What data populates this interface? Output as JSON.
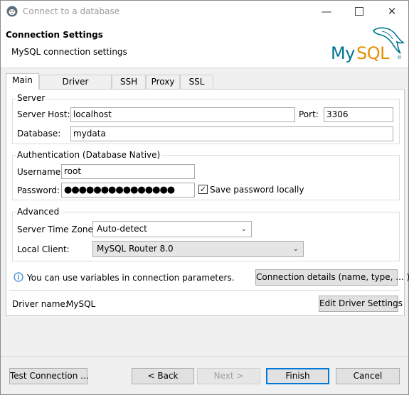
{
  "window": {
    "title": "Connect to a database"
  },
  "header": {
    "title": "Connection Settings",
    "subtitle": "MySQL connection settings",
    "logo_icon": "mysql-dolphin-logo"
  },
  "tabs": [
    {
      "label": "Main",
      "active": true
    },
    {
      "label": "Driver properties"
    },
    {
      "label": "SSH"
    },
    {
      "label": "Proxy"
    },
    {
      "label": "SSL"
    }
  ],
  "server": {
    "legend": "Server",
    "host_label": "Server Host:",
    "host_value": "localhost",
    "port_label": "Port:",
    "port_value": "3306",
    "database_label": "Database:",
    "database_value": "mydata"
  },
  "auth": {
    "legend": "Authentication (Database Native)",
    "username_label": "Username:",
    "username_value": "root",
    "password_label": "Password:",
    "password_value": "●●●●●●●●●●●●●●●",
    "save_password_label": "Save password locally",
    "save_password_checked": true
  },
  "advanced": {
    "legend": "Advanced",
    "timezone_label": "Server Time Zone:",
    "timezone_value": "Auto-detect",
    "client_label": "Local Client:",
    "client_value": "MySQL Router 8.0"
  },
  "info": {
    "text": "You can use variables in connection parameters.",
    "details_button": "Connection details (name, type, ... )"
  },
  "driver": {
    "label": "Driver name:",
    "value": "MySQL",
    "edit_button": "Edit Driver Settings"
  },
  "footer": {
    "test": "Test Connection ...",
    "back": "< Back",
    "next": "Next >",
    "finish": "Finish",
    "cancel": "Cancel"
  },
  "colors": {
    "accent": "#0078d7",
    "mysql_blue": "#00758f",
    "mysql_orange": "#e48e00"
  }
}
